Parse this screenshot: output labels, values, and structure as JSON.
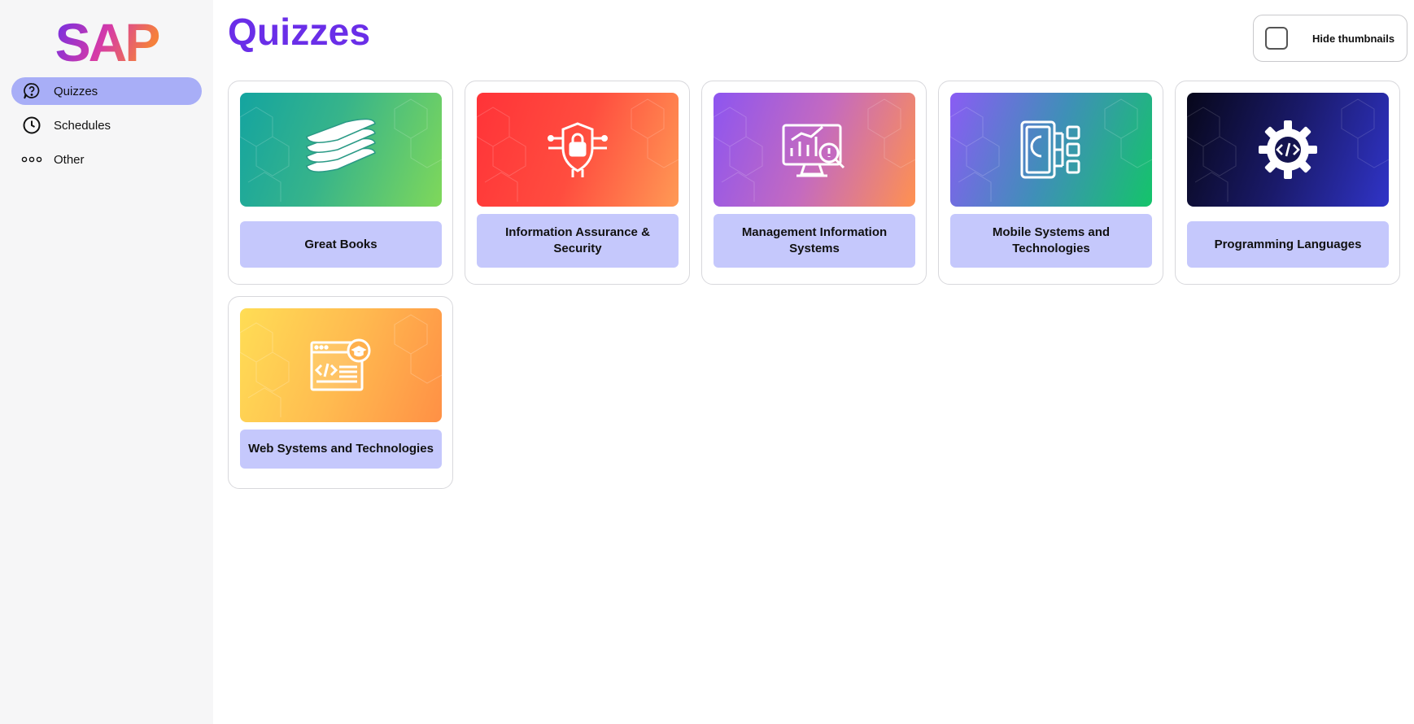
{
  "app": {
    "logo_text": "SAP",
    "logo_gradient": [
      "#6a2ee8",
      "#e63fa6",
      "#f5803c"
    ]
  },
  "sidebar": {
    "items": [
      {
        "label": "Quizzes",
        "icon": "question-bubble-icon",
        "active": true
      },
      {
        "label": "Schedules",
        "icon": "clock-icon",
        "active": false
      },
      {
        "label": "Other",
        "icon": "more-dots-icon",
        "active": false
      }
    ]
  },
  "main": {
    "title": "Quizzes",
    "hide_thumbnails": {
      "label": "Hide thumbnails",
      "checked": false
    },
    "quizzes": [
      {
        "label": "Great Books",
        "icon": "books-icon",
        "gradient": [
          "#14a4a0",
          "#7fd85a"
        ]
      },
      {
        "label": "Information Assurance & Security",
        "icon": "shield-lock-icon",
        "gradient": [
          "#ff3338",
          "#ff9a55"
        ]
      },
      {
        "label": "Management Information Systems",
        "icon": "monitor-analytics-icon",
        "gradient": [
          "#8d55f0",
          "#ff9150"
        ]
      },
      {
        "label": "Mobile Systems and Technologies",
        "icon": "mobile-network-icon",
        "gradient": [
          "#8a5cf4",
          "#14c46a"
        ]
      },
      {
        "label": "Programming Languages",
        "icon": "gear-code-icon",
        "gradient": [
          "#07071a",
          "#3034c8"
        ]
      },
      {
        "label": "Web Systems and Technologies",
        "icon": "web-code-icon",
        "gradient": [
          "#ffdd55",
          "#ff9045"
        ]
      }
    ]
  },
  "colors": {
    "accent": "#6a2ee8",
    "nav_active": "#a8aef7",
    "card_label_bg": "#c5c8fc",
    "sidebar_bg": "#f6f6f7"
  }
}
